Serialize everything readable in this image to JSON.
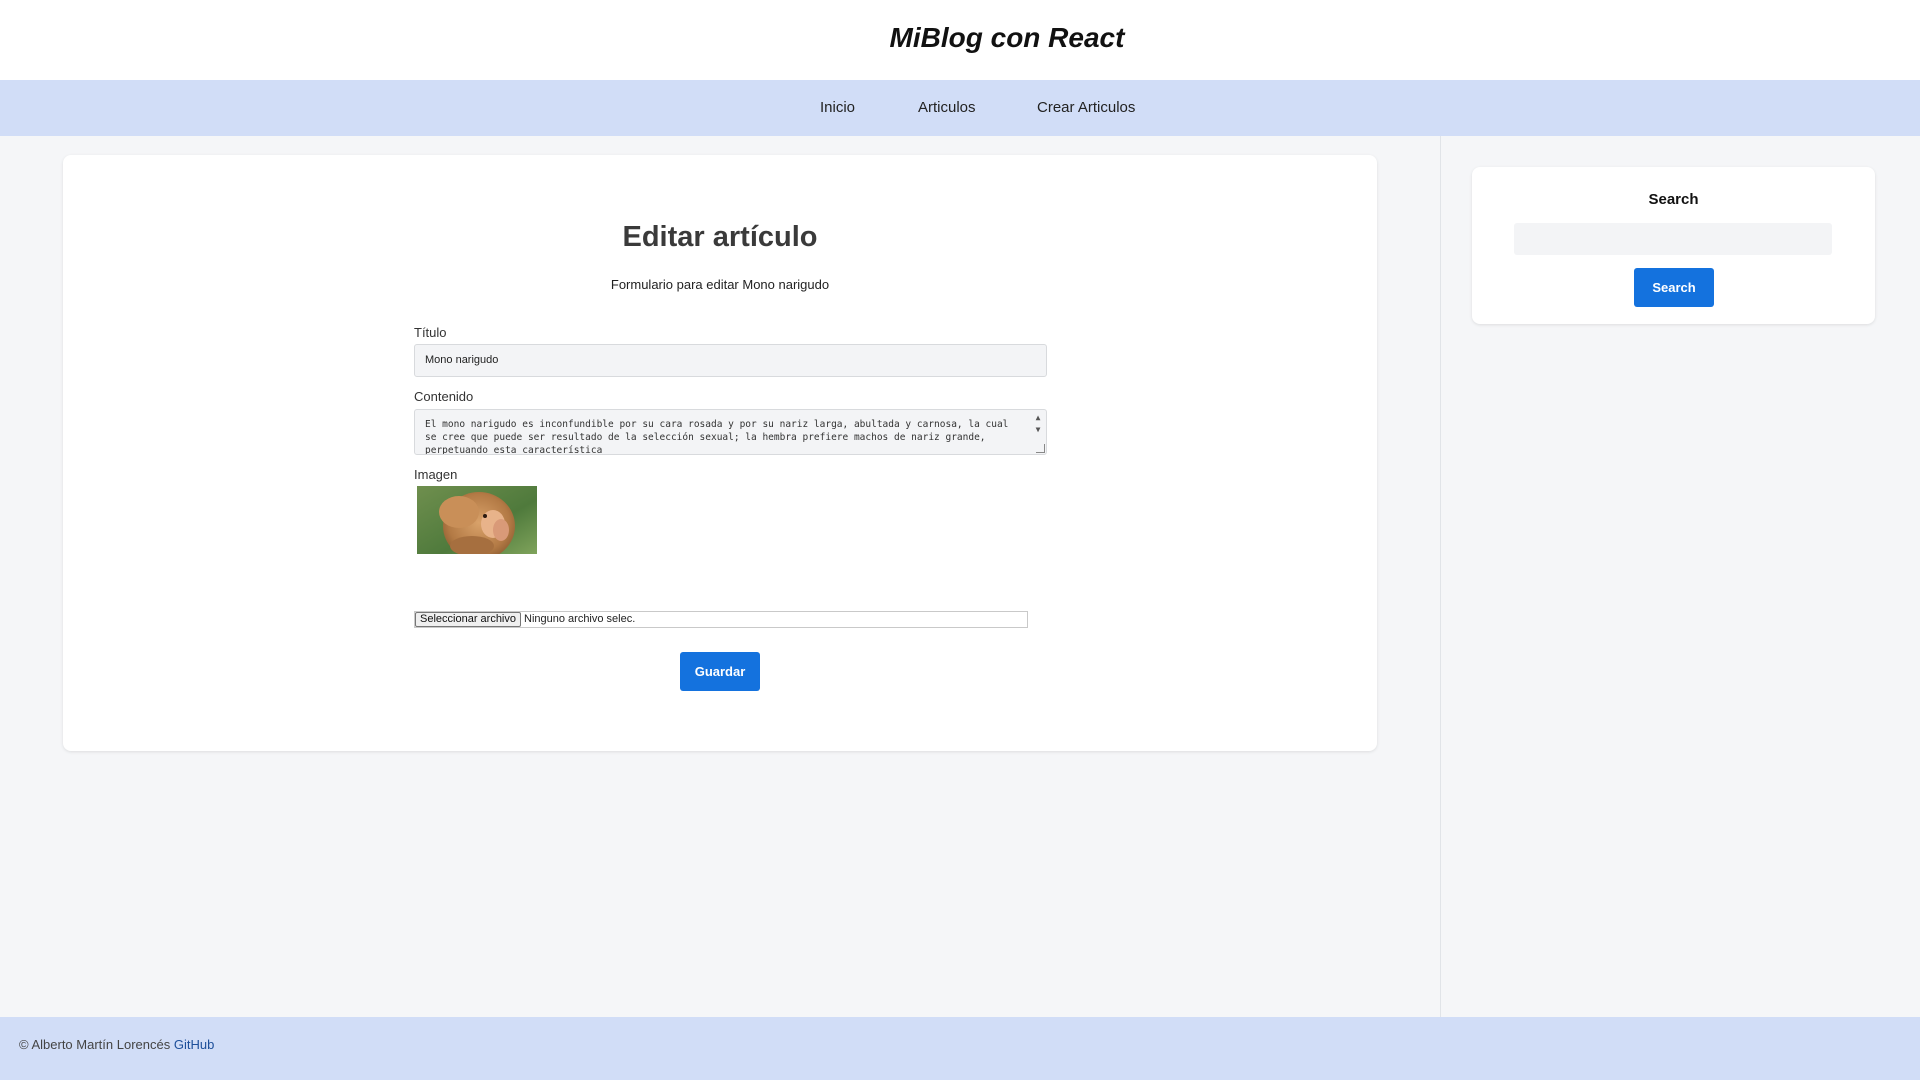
{
  "header": {
    "title": "MiBlog con React"
  },
  "nav": {
    "items": [
      {
        "label": "Inicio"
      },
      {
        "label": "Articulos"
      },
      {
        "label": "Crear Articulos"
      }
    ]
  },
  "form": {
    "heading": "Editar artículo",
    "subtitle": "Formulario para editar Mono narigudo",
    "title_label": "Título",
    "title_value": "Mono narigudo",
    "content_label": "Contenido",
    "content_value": "El mono narigudo es inconfundible por su cara rosada y por su nariz larga, abultada y carnosa, la cual se cree que puede ser resultado de la selección sexual; la hembra prefiere machos de nariz grande, perpetuando esta característica",
    "image_label": "Imagen",
    "file_button_label": "Seleccionar archivo",
    "file_status": "Ninguno archivo selec.",
    "save_label": "Guardar"
  },
  "sidebar": {
    "search_title": "Search",
    "search_placeholder": "",
    "search_button_label": "Search"
  },
  "footer": {
    "copyright": "© Alberto Martín Lorencés",
    "link_label": "GitHub"
  }
}
